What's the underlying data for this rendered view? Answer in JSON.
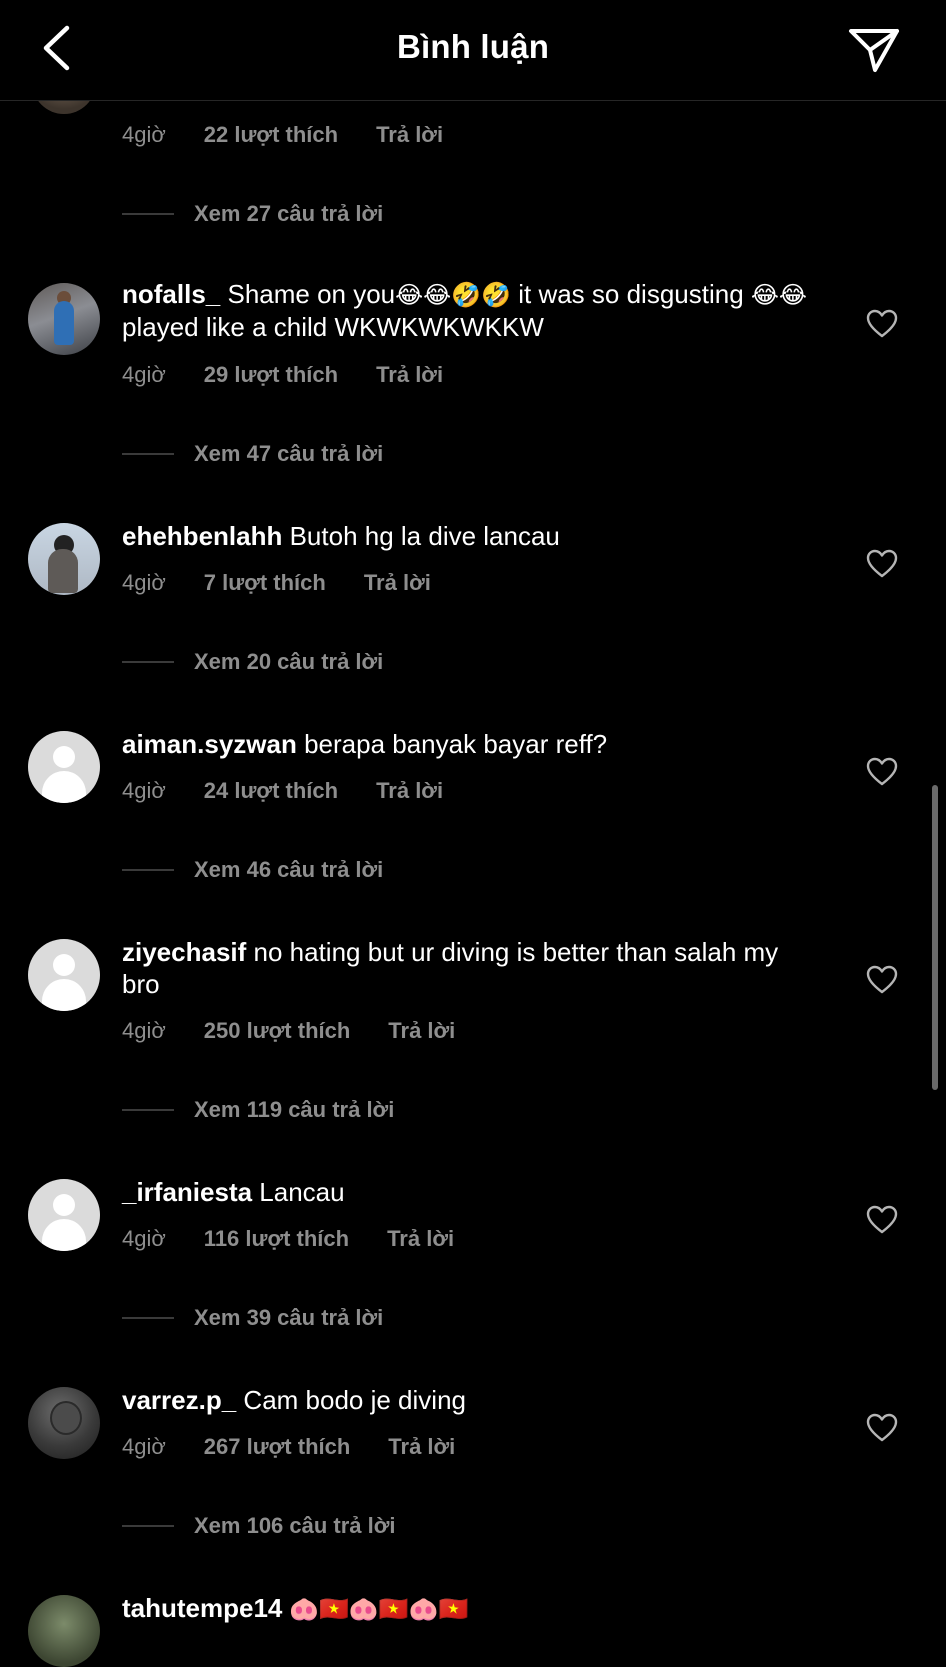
{
  "header": {
    "title": "Bình luận",
    "back_icon": "chevron-left-icon",
    "share_icon": "paper-plane-icon"
  },
  "top_partial": {
    "time": "4giờ",
    "likes": "22 lượt thích",
    "reply": "Trả lời",
    "view_replies": "Xem 27 câu trả lời"
  },
  "comments": [
    {
      "username": "nofalls_",
      "text_a": " Shame on you",
      "emoji_a": "😂😂🤣🤣",
      "text_b": " it was so disgusting ",
      "emoji_b": "😂😂",
      "text_c": " played like a child WKWKWKWKKW",
      "time": "4giờ",
      "likes": "29 lượt thích",
      "reply": "Trả lời",
      "view_replies": "Xem 47 câu trả lời"
    },
    {
      "username": "ehehbenlahh",
      "text": " Butoh hg la dive lancau",
      "time": "4giờ",
      "likes": "7 lượt thích",
      "reply": "Trả lời",
      "view_replies": "Xem 20 câu trả lời"
    },
    {
      "username": "aiman.syzwan",
      "text": " berapa banyak bayar reff?",
      "time": "4giờ",
      "likes": "24 lượt thích",
      "reply": "Trả lời",
      "view_replies": "Xem 46 câu trả lời"
    },
    {
      "username": "ziyechasif",
      "text": " no hating but ur diving is better than salah my bro",
      "time": "4giờ",
      "likes": "250 lượt thích",
      "reply": "Trả lời",
      "view_replies": "Xem 119 câu trả lời"
    },
    {
      "username": "_irfaniesta",
      "text": " Lancau",
      "time": "4giờ",
      "likes": "116 lượt thích",
      "reply": "Trả lời",
      "view_replies": "Xem 39 câu trả lời"
    },
    {
      "username": "varrez.p_",
      "text": " Cam bodo je diving",
      "time": "4giờ",
      "likes": "267 lượt thích",
      "reply": "Trả lời",
      "view_replies": "Xem 106 câu trả lời"
    },
    {
      "username": "tahutempe14",
      "text": "  🐽🇻🇳🐽🇻🇳🐽🇻🇳"
    }
  ],
  "icons": {
    "like": "heart-outline-icon",
    "avatar_default": "default-avatar-icon"
  },
  "colors": {
    "background": "#000000",
    "text": "#ffffff",
    "secondary": "#8e8e8e"
  }
}
